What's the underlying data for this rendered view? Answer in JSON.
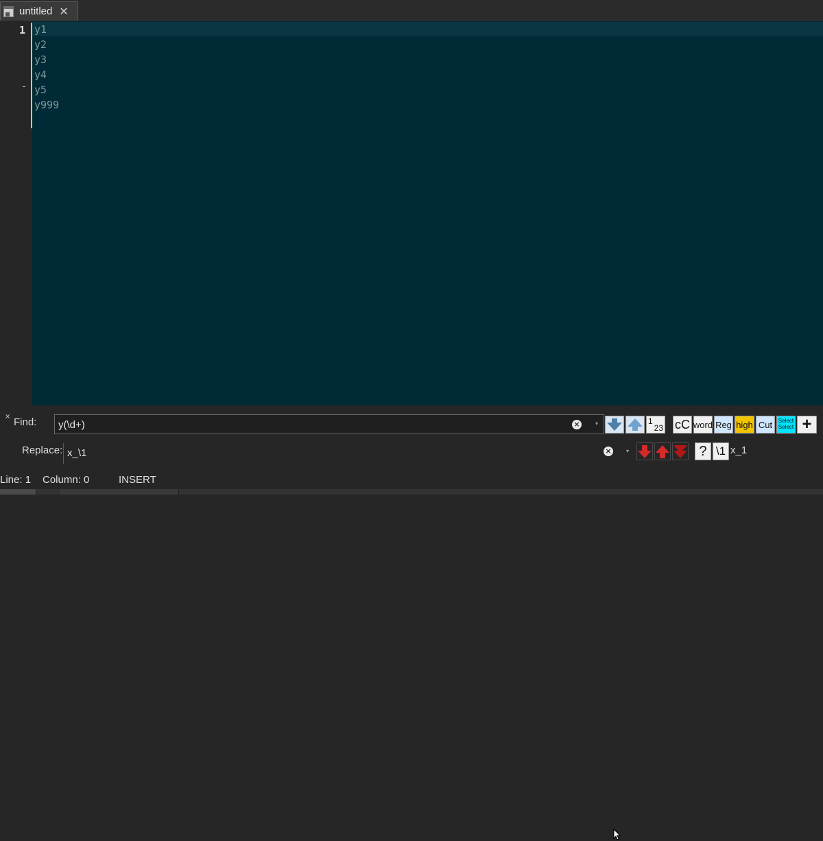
{
  "tab": {
    "title": "untitled",
    "close_glyph": "✕",
    "icon": "document-icon"
  },
  "editor": {
    "line_number": "1",
    "lines": [
      "y1",
      "y2",
      "y3",
      "y4",
      "y5",
      "y999"
    ],
    "colors": {
      "background": "#002a35",
      "text": "#7d9a9e",
      "current_line": "#093642",
      "change_bar": "#e5c84b"
    }
  },
  "find": {
    "close_glyph": "×",
    "find_label": "Find:",
    "find_value": "y(\\d+)",
    "replace_label": "Replace:",
    "replace_value": "x_\\1",
    "clear_glyph": "×",
    "buttons": {
      "sequence_sup": "1",
      "sequence_sub": "23",
      "case": "cC",
      "word": "word",
      "regex": "Reg",
      "highlight": "high",
      "cut": "Cut",
      "select_top": "Select",
      "select_bottom": "Select",
      "add": "+",
      "help": "?",
      "backref": "\\1"
    },
    "preview": "x_1",
    "colors": {
      "highlight": "#f2c400",
      "select": "#00e5ff",
      "regex": "#cfe6ff"
    }
  },
  "status": {
    "line": "Line: 1",
    "column": "Column: 0",
    "mode": "INSERT"
  }
}
